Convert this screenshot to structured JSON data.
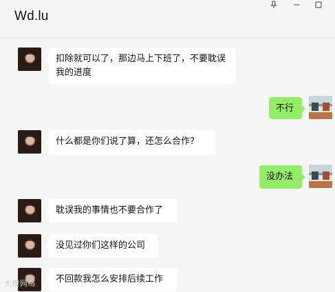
{
  "header": {
    "title": "Wd.lu",
    "pin_icon": "pin-icon",
    "minimize_icon": "minimize-icon",
    "maximize_icon": "maximize-icon"
  },
  "messages": [
    {
      "side": "left",
      "text": "扣除就可以了，那边马上下班了，不要耽误我的进度"
    },
    {
      "side": "right",
      "text": "不行"
    },
    {
      "side": "left",
      "text": "什么都是你们说了算，还怎么合作？"
    },
    {
      "side": "right",
      "text": "没办法"
    },
    {
      "side": "left",
      "text": "耽误我的事情也不要合作了"
    },
    {
      "side": "left",
      "text": "没见过你们这样的公司"
    },
    {
      "side": "left",
      "text": "不回款我怎么安排后续工作"
    }
  ],
  "watermark": "大橙网络",
  "colors": {
    "background": "#f5f5f5",
    "bubble_left": "#ffffff",
    "bubble_right": "#95ec69"
  }
}
